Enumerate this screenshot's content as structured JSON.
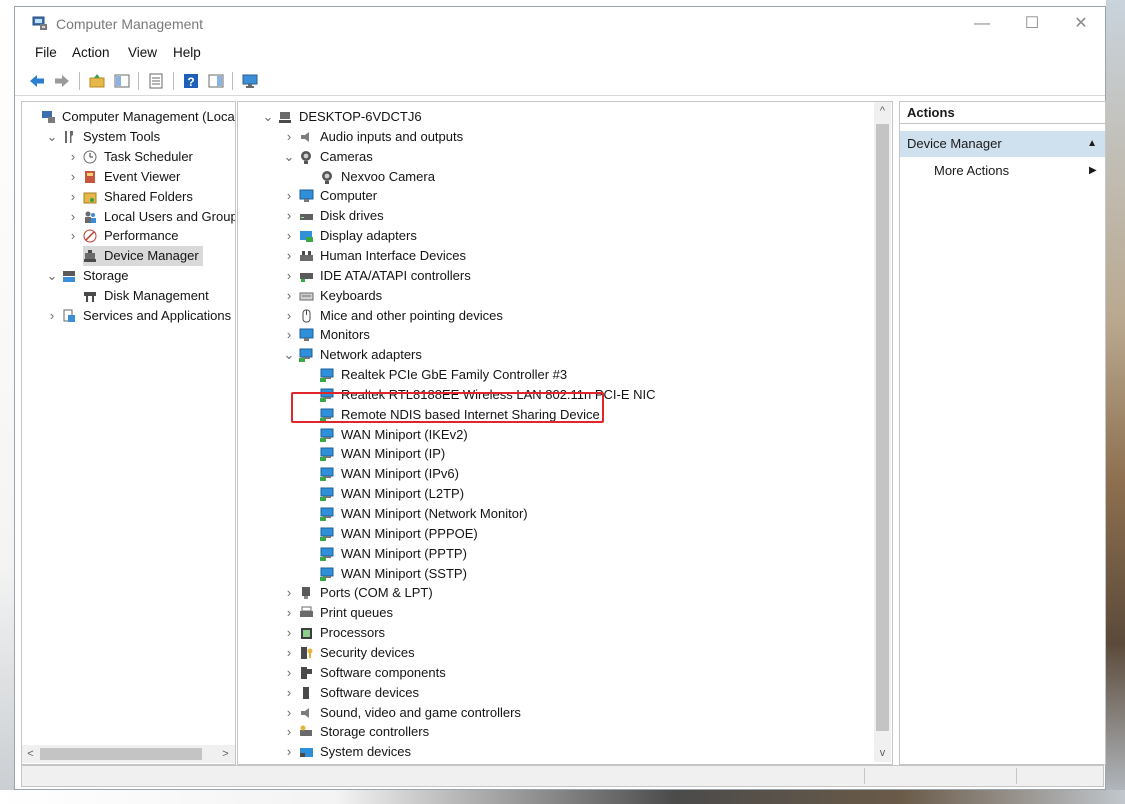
{
  "window": {
    "title": "Computer Management",
    "controls": {
      "minimize": "—",
      "maximize": "☐",
      "close": "✕"
    }
  },
  "menu": [
    "File",
    "Action",
    "View",
    "Help"
  ],
  "toolbar": [
    "back-icon",
    "forward-icon",
    "up-folder-icon",
    "show-tree-icon",
    "properties-icon",
    "help-icon",
    "show-actions-icon",
    "monitor-icon"
  ],
  "left_tree": [
    {
      "label": "Computer Management (Local",
      "icon": "computer-management-icon",
      "level": 0,
      "arrow": ""
    },
    {
      "label": "System Tools",
      "icon": "tools-icon",
      "level": 1,
      "arrow": "v"
    },
    {
      "label": "Task Scheduler",
      "icon": "clock-icon",
      "level": 2,
      "arrow": ">"
    },
    {
      "label": "Event Viewer",
      "icon": "event-viewer-icon",
      "level": 2,
      "arrow": ">"
    },
    {
      "label": "Shared Folders",
      "icon": "shared-folder-icon",
      "level": 2,
      "arrow": ">"
    },
    {
      "label": "Local Users and Groups",
      "icon": "users-icon",
      "level": 2,
      "arrow": ">"
    },
    {
      "label": "Performance",
      "icon": "performance-icon",
      "level": 2,
      "arrow": ">"
    },
    {
      "label": "Device Manager",
      "icon": "device-manager-icon",
      "level": 2,
      "arrow": "",
      "selected": true
    },
    {
      "label": "Storage",
      "icon": "storage-icon",
      "level": 1,
      "arrow": "v"
    },
    {
      "label": "Disk Management",
      "icon": "disk-management-icon",
      "level": 2,
      "arrow": ""
    },
    {
      "label": "Services and Applications",
      "icon": "services-icon",
      "level": 1,
      "arrow": ">"
    }
  ],
  "device_tree": [
    {
      "label": "DESKTOP-6VDCTJ6",
      "icon": "computer-root-icon",
      "level": 0,
      "arrow": "v"
    },
    {
      "label": "Audio inputs and outputs",
      "icon": "speaker-icon",
      "level": 1,
      "arrow": ">"
    },
    {
      "label": "Cameras",
      "icon": "camera-icon",
      "level": 1,
      "arrow": "v"
    },
    {
      "label": "Nexvoo Camera",
      "icon": "camera-icon",
      "level": 2,
      "arrow": ""
    },
    {
      "label": "Computer",
      "icon": "monitor-icon",
      "level": 1,
      "arrow": ">"
    },
    {
      "label": "Disk drives",
      "icon": "disk-drive-icon",
      "level": 1,
      "arrow": ">"
    },
    {
      "label": "Display adapters",
      "icon": "display-adapter-icon",
      "level": 1,
      "arrow": ">"
    },
    {
      "label": "Human Interface Devices",
      "icon": "hid-icon",
      "level": 1,
      "arrow": ">"
    },
    {
      "label": "IDE ATA/ATAPI controllers",
      "icon": "ide-controller-icon",
      "level": 1,
      "arrow": ">"
    },
    {
      "label": "Keyboards",
      "icon": "keyboard-icon",
      "level": 1,
      "arrow": ">"
    },
    {
      "label": "Mice and other pointing devices",
      "icon": "mouse-icon",
      "level": 1,
      "arrow": ">"
    },
    {
      "label": "Monitors",
      "icon": "monitor-icon",
      "level": 1,
      "arrow": ">"
    },
    {
      "label": "Network adapters",
      "icon": "network-adapter-icon",
      "level": 1,
      "arrow": "v"
    },
    {
      "label": "Realtek PCIe GbE Family Controller #3",
      "icon": "network-adapter-icon",
      "level": 2,
      "arrow": ""
    },
    {
      "label": "Realtek RTL8188EE Wireless LAN 802.11n PCI-E NIC",
      "icon": "network-adapter-icon",
      "level": 2,
      "arrow": ""
    },
    {
      "label": "Remote NDIS based Internet Sharing Device",
      "icon": "network-adapter-icon",
      "level": 2,
      "arrow": "",
      "highlighted": true
    },
    {
      "label": "WAN Miniport (IKEv2)",
      "icon": "network-adapter-icon",
      "level": 2,
      "arrow": ""
    },
    {
      "label": "WAN Miniport (IP)",
      "icon": "network-adapter-icon",
      "level": 2,
      "arrow": ""
    },
    {
      "label": "WAN Miniport (IPv6)",
      "icon": "network-adapter-icon",
      "level": 2,
      "arrow": ""
    },
    {
      "label": "WAN Miniport (L2TP)",
      "icon": "network-adapter-icon",
      "level": 2,
      "arrow": ""
    },
    {
      "label": "WAN Miniport (Network Monitor)",
      "icon": "network-adapter-icon",
      "level": 2,
      "arrow": ""
    },
    {
      "label": "WAN Miniport (PPPOE)",
      "icon": "network-adapter-icon",
      "level": 2,
      "arrow": ""
    },
    {
      "label": "WAN Miniport (PPTP)",
      "icon": "network-adapter-icon",
      "level": 2,
      "arrow": ""
    },
    {
      "label": "WAN Miniport (SSTP)",
      "icon": "network-adapter-icon",
      "level": 2,
      "arrow": ""
    },
    {
      "label": "Ports (COM & LPT)",
      "icon": "port-icon",
      "level": 1,
      "arrow": ">"
    },
    {
      "label": "Print queues",
      "icon": "printer-icon",
      "level": 1,
      "arrow": ">"
    },
    {
      "label": "Processors",
      "icon": "processor-icon",
      "level": 1,
      "arrow": ">"
    },
    {
      "label": "Security devices",
      "icon": "security-device-icon",
      "level": 1,
      "arrow": ">"
    },
    {
      "label": "Software components",
      "icon": "software-component-icon",
      "level": 1,
      "arrow": ">"
    },
    {
      "label": "Software devices",
      "icon": "software-device-icon",
      "level": 1,
      "arrow": ">"
    },
    {
      "label": "Sound, video and game controllers",
      "icon": "speaker-icon",
      "level": 1,
      "arrow": ">"
    },
    {
      "label": "Storage controllers",
      "icon": "storage-controller-icon",
      "level": 1,
      "arrow": ">"
    },
    {
      "label": "System devices",
      "icon": "system-device-icon",
      "level": 1,
      "arrow": ">"
    }
  ],
  "actions": {
    "title": "Actions",
    "section": "Device Manager",
    "more": "More Actions"
  },
  "colors": {
    "highlight_box": "#e0262a",
    "selected_row": "#d9d9d9",
    "actions_section": "#cfe0ee",
    "network_blue": "#2f8fd8",
    "network_green": "#39a845"
  }
}
